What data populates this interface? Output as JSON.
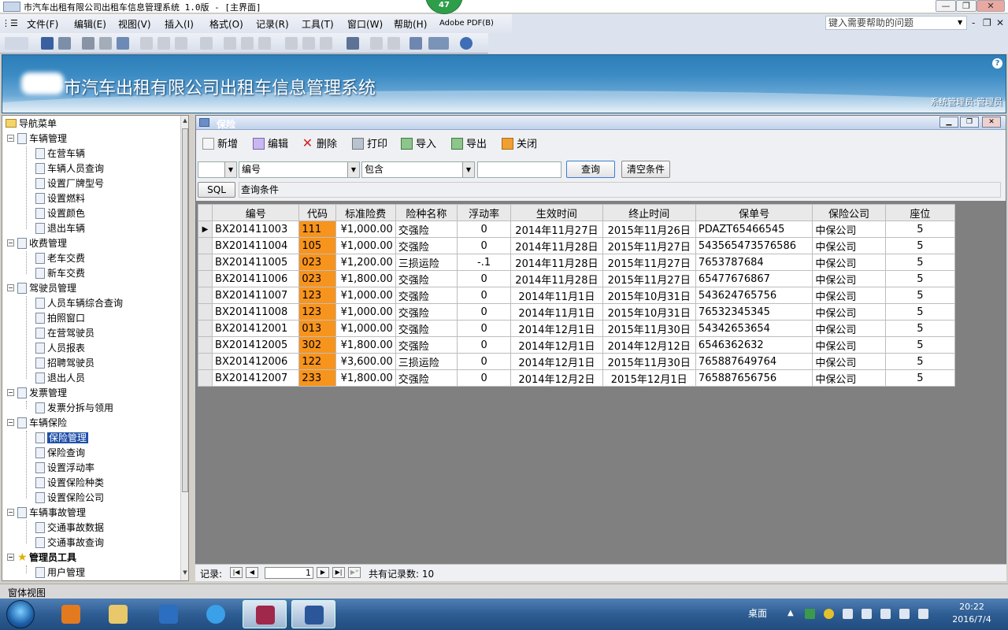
{
  "titlebar": {
    "title": "市汽车出租有限公司出租车信息管理系统 1.0版 - [主界面]"
  },
  "floating_badge": "47",
  "menubar": {
    "items": [
      "文件(F)",
      "编辑(E)",
      "视图(V)",
      "插入(I)",
      "格式(O)",
      "记录(R)",
      "工具(T)",
      "窗口(W)",
      "帮助(H)",
      "Adobe PDF(B)"
    ]
  },
  "help_box": {
    "placeholder": "键入需要帮助的问题"
  },
  "banner": {
    "title": "市汽车出租有限公司出租车信息管理系统",
    "user": "系统管理员:管理员",
    "help": "?"
  },
  "nav": {
    "root": "导航菜单",
    "groups": [
      {
        "label": "车辆管理",
        "items": [
          "在营车辆",
          "车辆人员查询",
          "设置厂牌型号",
          "设置燃料",
          "设置颜色",
          "退出车辆"
        ]
      },
      {
        "label": "收费管理",
        "items": [
          "老车交费",
          "新车交费"
        ]
      },
      {
        "label": "驾驶员管理",
        "items": [
          "人员车辆综合查询",
          "拍照窗口",
          "在营驾驶员",
          "人员报表",
          "招聘驾驶员",
          "退出人员"
        ]
      },
      {
        "label": "发票管理",
        "items": [
          "发票分拆与领用"
        ]
      },
      {
        "label": "车辆保险",
        "items": [
          "保险管理",
          "保险查询",
          "设置浮动率",
          "设置保险种类",
          "设置保险公司"
        ]
      },
      {
        "label": "车辆事故管理",
        "items": [
          "交通事故数据",
          "交通事故查询"
        ]
      },
      {
        "label": "管理员工具",
        "items": [
          "用户管理"
        ]
      }
    ]
  },
  "panel": {
    "title": "保险",
    "toolbar": [
      "新增",
      "编辑",
      "删除",
      "打印",
      "导入",
      "导出",
      "关闭"
    ],
    "filter": {
      "field": "编号",
      "op": "包含",
      "value": "",
      "query": "查询",
      "clear": "清空条件"
    },
    "sql": {
      "button": "SQL",
      "label": "查询条件"
    },
    "columns": [
      "编号",
      "代码",
      "标准险费",
      "险种名称",
      "浮动率",
      "生效时间",
      "终止时间",
      "保单号",
      "保险公司",
      "座位"
    ],
    "rows": [
      [
        "BX201411003",
        "111",
        "¥1,000.00",
        "交强险",
        "0",
        "2014年11月27日",
        "2015年11月26日",
        "PDAZT65466545",
        "中保公司",
        "5"
      ],
      [
        "BX201411004",
        "105",
        "¥1,000.00",
        "交强险",
        "0",
        "2014年11月28日",
        "2015年11月27日",
        "543565473576586",
        "中保公司",
        "5"
      ],
      [
        "BX201411005",
        "023",
        "¥1,200.00",
        "三损运险",
        "-.1",
        "2014年11月28日",
        "2015年11月27日",
        "7653787684",
        "中保公司",
        "5"
      ],
      [
        "BX201411006",
        "023",
        "¥1,800.00",
        "交强险",
        "0",
        "2014年11月28日",
        "2015年11月27日",
        "65477676867",
        "中保公司",
        "5"
      ],
      [
        "BX201411007",
        "123",
        "¥1,000.00",
        "交强险",
        "0",
        "2014年11月1日",
        "2015年10月31日",
        "543624765756",
        "中保公司",
        "5"
      ],
      [
        "BX201411008",
        "123",
        "¥1,000.00",
        "交强险",
        "0",
        "2014年11月1日",
        "2015年10月31日",
        "76532345345",
        "中保公司",
        "5"
      ],
      [
        "BX201412001",
        "013",
        "¥1,000.00",
        "交强险",
        "0",
        "2014年12月1日",
        "2015年11月30日",
        "54342653654",
        "中保公司",
        "5"
      ],
      [
        "BX201412005",
        "302",
        "¥1,800.00",
        "交强险",
        "0",
        "2014年12月1日",
        "2014年12月12日",
        "6546362632",
        "中保公司",
        "5"
      ],
      [
        "BX201412006",
        "122",
        "¥3,600.00",
        "三损运险",
        "0",
        "2014年12月1日",
        "2015年11月30日",
        "765887649764",
        "中保公司",
        "5"
      ],
      [
        "BX201412007",
        "233",
        "¥1,800.00",
        "交强险",
        "0",
        "2014年12月2日",
        "2015年12月1日",
        "765887656756",
        "中保公司",
        "5"
      ]
    ]
  },
  "record_nav": {
    "label": "记录:",
    "current": "1",
    "total_label": "共有记录数: 10"
  },
  "statusbar": {
    "text": "窗体视图"
  },
  "taskbar": {
    "desktop": "桌面",
    "time": "20:22",
    "date": "2016/7/4"
  },
  "colors": {
    "code_cell": "#f7941d",
    "banner": "#2d7fb9",
    "selection": "#1e4fa8"
  }
}
